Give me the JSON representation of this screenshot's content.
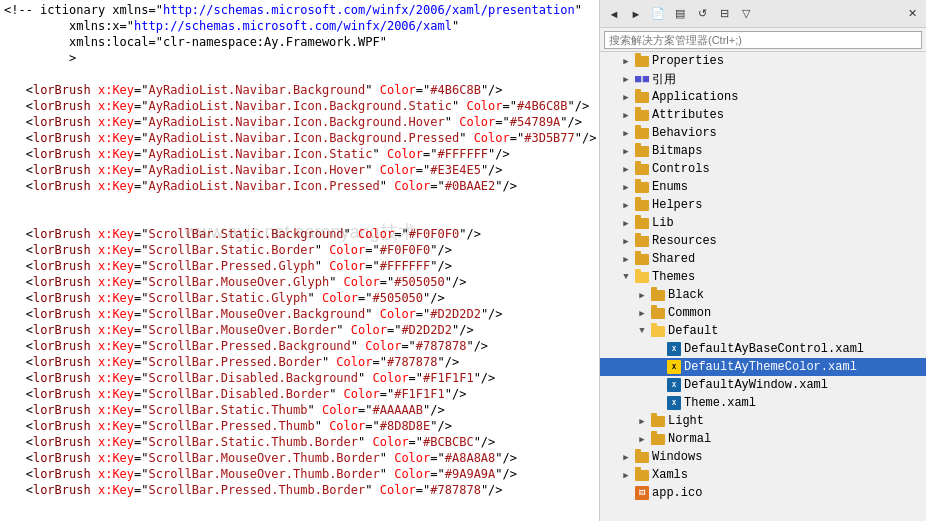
{
  "solution_explorer": {
    "title": "搜索解决方案管理器(Ctrl+;)",
    "search_placeholder": "搜索解决方案管理器(Ctrl+;)",
    "watermark": "www.ayjs.net   aaronyang技术",
    "toolbar_buttons": [
      "←",
      "→",
      "↑",
      "↓",
      "↕",
      "📋",
      "🔍",
      "⚙"
    ],
    "tree": [
      {
        "id": "properties",
        "label": "Properties",
        "indent": 1,
        "type": "folder",
        "state": "collapsed"
      },
      {
        "id": "references",
        "label": "引用",
        "indent": 1,
        "type": "references",
        "state": "collapsed"
      },
      {
        "id": "applications",
        "label": "Applications",
        "indent": 1,
        "type": "folder",
        "state": "collapsed"
      },
      {
        "id": "attributes",
        "label": "Attributes",
        "indent": 1,
        "type": "folder",
        "state": "collapsed"
      },
      {
        "id": "behaviors",
        "label": "Behaviors",
        "indent": 1,
        "type": "folder",
        "state": "collapsed"
      },
      {
        "id": "bitmaps",
        "label": "Bitmaps",
        "indent": 1,
        "type": "folder",
        "state": "collapsed"
      },
      {
        "id": "controls",
        "label": "Controls",
        "indent": 1,
        "type": "folder",
        "state": "collapsed"
      },
      {
        "id": "enums",
        "label": "Enums",
        "indent": 1,
        "type": "folder",
        "state": "collapsed"
      },
      {
        "id": "helpers",
        "label": "Helpers",
        "indent": 1,
        "type": "folder",
        "state": "collapsed"
      },
      {
        "id": "lib",
        "label": "Lib",
        "indent": 1,
        "type": "folder",
        "state": "collapsed"
      },
      {
        "id": "resources",
        "label": "Resources",
        "indent": 1,
        "type": "folder",
        "state": "collapsed"
      },
      {
        "id": "shared",
        "label": "Shared",
        "indent": 1,
        "type": "folder",
        "state": "collapsed"
      },
      {
        "id": "themes",
        "label": "Themes",
        "indent": 1,
        "type": "folder",
        "state": "expanded"
      },
      {
        "id": "black",
        "label": "Black",
        "indent": 2,
        "type": "folder",
        "state": "collapsed"
      },
      {
        "id": "common",
        "label": "Common",
        "indent": 2,
        "type": "folder",
        "state": "collapsed"
      },
      {
        "id": "default",
        "label": "Default",
        "indent": 2,
        "type": "folder",
        "state": "expanded"
      },
      {
        "id": "defaultaybasecontrol",
        "label": "DefaultAyBaseControl.xaml",
        "indent": 3,
        "type": "xaml",
        "state": "none"
      },
      {
        "id": "defaultaythemecolor",
        "label": "DefaultAyThemeColor.xaml",
        "indent": 3,
        "type": "xaml",
        "state": "selected"
      },
      {
        "id": "defaultaywindow",
        "label": "DefaultAyWindow.xaml",
        "indent": 3,
        "type": "xaml",
        "state": "none"
      },
      {
        "id": "theme",
        "label": "Theme.xaml",
        "indent": 3,
        "type": "xaml",
        "state": "none"
      },
      {
        "id": "light",
        "label": "Light",
        "indent": 2,
        "type": "folder",
        "state": "collapsed"
      },
      {
        "id": "normal",
        "label": "Normal",
        "indent": 2,
        "type": "folder",
        "state": "collapsed"
      },
      {
        "id": "windows",
        "label": "Windows",
        "indent": 1,
        "type": "folder",
        "state": "collapsed"
      },
      {
        "id": "xamls",
        "label": "Xamls",
        "indent": 1,
        "type": "folder",
        "state": "collapsed"
      },
      {
        "id": "appico",
        "label": "app.ico",
        "indent": 1,
        "type": "ico",
        "state": "none"
      }
    ]
  },
  "code_lines": [
    {
      "text": "ictionary xmlns=\"http://schemas.microsoft.com/winfx/2006/xaml/presentation\"",
      "type": "mixed"
    },
    {
      "text": "         xmlns:x=\"http://schemas.microsoft.com/winfx/2006/xaml\"",
      "type": "mixed"
    },
    {
      "text": "         xmlns:local=\"clr-namespace:Ay.Framework.WPF\"",
      "type": "mixed"
    },
    {
      "text": "         >",
      "type": "tag"
    },
    {
      "text": "",
      "type": "empty"
    },
    {
      "text": "lorBrush x:Key=\"AyRadioList.Navibar.Background\" Color=\"#4B6C8B\"/>",
      "type": "attr"
    },
    {
      "text": "lorBrush x:Key=\"AyRadioList.Navibar.Icon.Background.Static\" Color=\"#4B6C8B\"/>",
      "type": "attr"
    },
    {
      "text": "lorBrush x:Key=\"AyRadioList.Navibar.Icon.Background.Hover\" Color=\"#54789A\"/>",
      "type": "attr"
    },
    {
      "text": "lorBrush x:Key=\"AyRadioList.Navibar.Icon.Background.Pressed\" Color=\"#3D5B77\"/>",
      "type": "attr"
    },
    {
      "text": "lorBrush x:Key=\"AyRadioList.Navibar.Icon.Static\" Color=\"#FFFFFF\"/>",
      "type": "attr"
    },
    {
      "text": "lorBrush x:Key=\"AyRadioList.Navibar.Icon.Hover\" Color=\"#E3E4E5\"/>",
      "type": "attr"
    },
    {
      "text": "lorBrush x:Key=\"AyRadioList.Navibar.Icon.Pressed\" Color=\"#0BAAE2\"/>",
      "type": "attr"
    },
    {
      "text": "",
      "type": "empty"
    },
    {
      "text": "",
      "type": "empty"
    },
    {
      "text": "lorBrush x:Key=\"ScrollBar.Static.Background\" Color=\"#F0F0F0\"/>",
      "type": "attr"
    },
    {
      "text": "lorBrush x:Key=\"ScrollBar.Static.Border\" Color=\"#F0F0F0\"/>",
      "type": "attr"
    },
    {
      "text": "lorBrush x:Key=\"ScrollBar.Pressed.Glyph\" Color=\"#FFFFFF\"/>",
      "type": "attr"
    },
    {
      "text": "lorBrush x:Key=\"ScrollBar.MouseOver.Glyph\" Color=\"#505050\"/>",
      "type": "attr"
    },
    {
      "text": "lorBrush x:Key=\"ScrollBar.Static.Glyph\" Color=\"#505050\"/>",
      "type": "attr"
    },
    {
      "text": "lorBrush x:Key=\"ScrollBar.MouseOver.Background\" Color=\"#D2D2D2\"/>",
      "type": "attr"
    },
    {
      "text": "lorBrush x:Key=\"ScrollBar.MouseOver.Border\" Color=\"#D2D2D2\"/>",
      "type": "attr"
    },
    {
      "text": "lorBrush x:Key=\"ScrollBar.Pressed.Background\" Color=\"#787878\"/>",
      "type": "attr"
    },
    {
      "text": "lorBrush x:Key=\"ScrollBar.Pressed.Border\" Color=\"#787878\"/>",
      "type": "attr"
    },
    {
      "text": "lorBrush x:Key=\"ScrollBar.Disabled.Background\" Color=\"#F1F1F1\"/>",
      "type": "attr"
    },
    {
      "text": "lorBrush x:Key=\"ScrollBar.Disabled.Border\" Color=\"#F1F1F1\"/>",
      "type": "attr"
    },
    {
      "text": "lorBrush x:Key=\"ScrollBar.Static.Thumb\" Color=\"#AAAAAB\"/>",
      "type": "attr"
    },
    {
      "text": "lorBrush x:Key=\"ScrollBar.Pressed.Thumb\" Color=\"#8D8D8E\"/>",
      "type": "attr"
    },
    {
      "text": "lorBrush x:Key=\"ScrollBar.Static.Thumb.Border\" Color=\"#BCBCBC\"/>",
      "type": "attr"
    },
    {
      "text": "lorBrush x:Key=\"ScrollBar.MouseOver.Thumb.Border\" Color=\"#A8A8A8\"/>",
      "type": "attr"
    },
    {
      "text": "lorBrush x:Key=\"ScrollBar.MouseOver.Thumb.Border\" Color=\"#9A9A9A\"/>",
      "type": "attr"
    },
    {
      "text": "lorBrush x:Key=\"ScrollBar.Pressed.Thumb.Border\" Color=\"#787878\"/>",
      "type": "attr"
    }
  ]
}
